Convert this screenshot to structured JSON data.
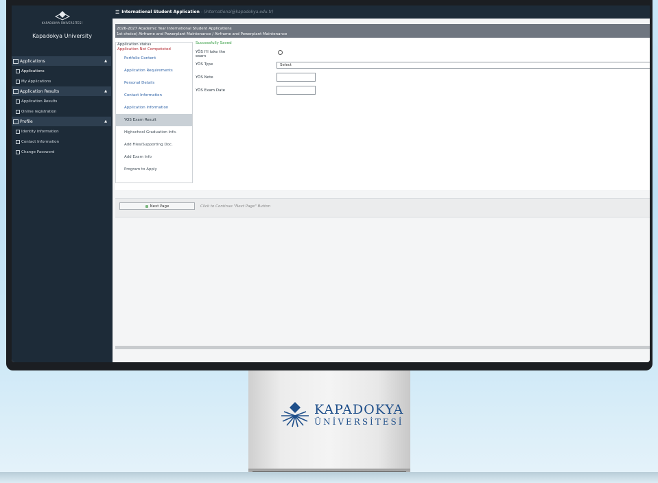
{
  "sidebar": {
    "logo_small_text": "KAPADOKYA ÜNİVERSİTESİ",
    "university_name": "Kapadokya University",
    "sections": [
      {
        "title": "Applications",
        "items": [
          "Applications",
          "My Applications"
        ]
      },
      {
        "title": "Application Results",
        "items": [
          "Application Results",
          "Online registration"
        ]
      },
      {
        "title": "Profile",
        "items": [
          "Identity information",
          "Contact Information",
          "Change Password"
        ]
      }
    ]
  },
  "topbar": {
    "title": "International Student Application",
    "separator": " - ",
    "email": "(international@kapadokya.edu.tr)"
  },
  "band": {
    "line1": "2026-2027 Academic Year International Student Applications",
    "line2": "1st choice) Airframe and Powerplant Maintenance / Airframe and Powerplant Maintenance"
  },
  "status": {
    "label": "Application status",
    "value": "Application Not Competeted",
    "steps": [
      "Portfolio Content",
      "Application Requirements",
      "Personal Details",
      "Contact Information",
      "Application Information",
      "YOS Exam Result",
      "Highschool Graduation Info.",
      "Add Files/Supporting Doc.",
      "Add Exam Info",
      "Program to Apply"
    ]
  },
  "form": {
    "saved": "Successfully Saved",
    "take_exam_label": "YÖS I'll take the exam",
    "type_label": "YÖS Type",
    "type_value": "Select",
    "note_label": "YÖS Note",
    "date_label": "YÖS Exam Date"
  },
  "actions": {
    "next": "Next Page",
    "hint": "Click to Continue \"Next Page\" Button"
  },
  "brand": {
    "title": "KAPADOKYA",
    "subtitle": "ÜNİVERSİTESİ"
  },
  "colors": {
    "sidebar": "#1d2b38",
    "link": "#2f63a7",
    "error": "#b3262e",
    "success": "#2f9a3d",
    "brand": "#1f4f8a"
  }
}
